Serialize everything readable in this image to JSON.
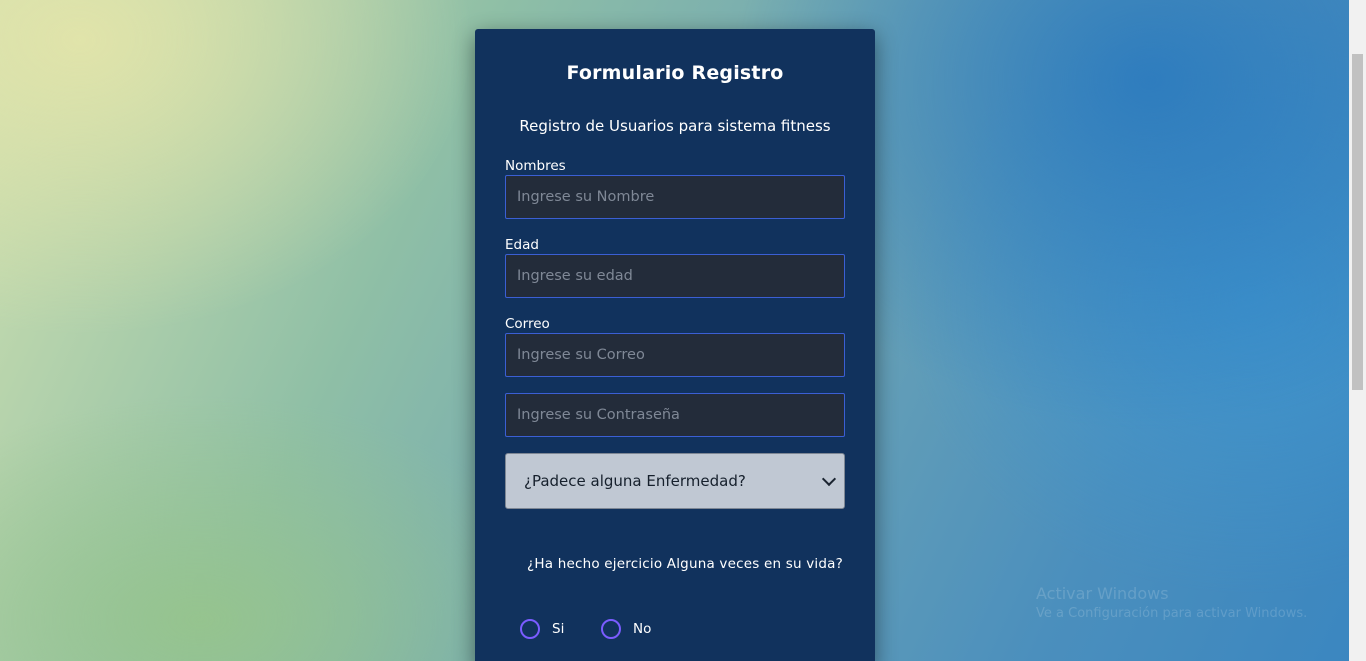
{
  "form": {
    "title": "Formulario Registro",
    "subtitle": "Registro de Usuarios para sistema fitness",
    "fields": {
      "nombres": {
        "label": "Nombres",
        "placeholder": "Ingrese su Nombre",
        "value": ""
      },
      "edad": {
        "label": "Edad",
        "placeholder": "Ingrese su edad",
        "value": ""
      },
      "correo": {
        "label": "Correo",
        "placeholder": "Ingrese su Correo",
        "value": ""
      },
      "contrasena": {
        "placeholder": "Ingrese su Contraseña",
        "value": ""
      }
    },
    "enfermedad_select": {
      "selected": "¿Padece alguna Enfermedad?"
    },
    "ejercicio": {
      "question": "¿Ha hecho ejercicio Alguna veces en su vida?",
      "options": [
        {
          "label": "Si",
          "checked": false
        },
        {
          "label": "No",
          "checked": false
        }
      ]
    }
  },
  "watermark": {
    "line1": "Activar Windows",
    "line2": "Ve a Configuración para activar Windows."
  },
  "colors": {
    "card_bg": "#11325d",
    "input_bg": "#232c3a",
    "input_border": "#3b5fd4",
    "radio_border": "#7a5cff",
    "select_bg": "#c0c8d3"
  }
}
